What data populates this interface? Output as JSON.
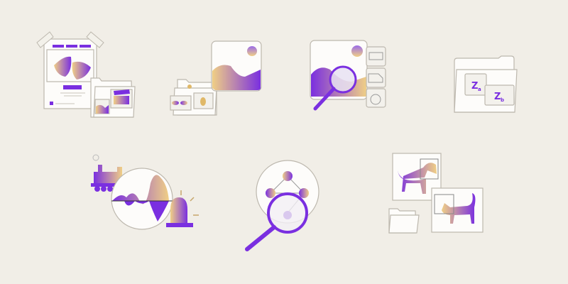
{
  "colors": {
    "background": "#f1eee7",
    "accent": "#7a2fe0",
    "gold": "#e8c47a",
    "outline": "#bdb8ae"
  },
  "folder_labels": {
    "za_main": "Z",
    "za_sub": "a",
    "zb_main": "Z",
    "zb_sub": "b"
  },
  "icons": [
    "theater-poster-icon",
    "image-folder-icon",
    "image-search-icon",
    "sorted-folder-icon",
    "anomaly-alert-icon",
    "graph-search-icon",
    "object-detection-icon"
  ]
}
